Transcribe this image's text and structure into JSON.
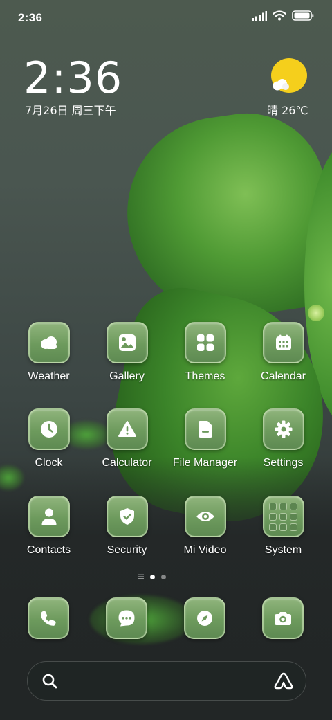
{
  "status_bar": {
    "time": "2:36"
  },
  "clock_widget": {
    "time": "2:36",
    "date": "7月26日 周三下午"
  },
  "weather_widget": {
    "condition": "晴",
    "temperature": "26℃"
  },
  "apps": [
    {
      "label": "Weather",
      "icon": "weather-icon"
    },
    {
      "label": "Gallery",
      "icon": "gallery-icon"
    },
    {
      "label": "Themes",
      "icon": "themes-icon"
    },
    {
      "label": "Calendar",
      "icon": "calendar-icon"
    },
    {
      "label": "Clock",
      "icon": "clock-icon"
    },
    {
      "label": "Calculator",
      "icon": "calculator-icon"
    },
    {
      "label": "File Manager",
      "icon": "file-manager-icon"
    },
    {
      "label": "Settings",
      "icon": "settings-icon"
    },
    {
      "label": "Contacts",
      "icon": "contacts-icon"
    },
    {
      "label": "Security",
      "icon": "security-icon"
    },
    {
      "label": "Mi Video",
      "icon": "mi-video-icon"
    },
    {
      "label": "System",
      "icon": "folder-icon"
    }
  ],
  "dock": [
    {
      "icon": "phone-icon"
    },
    {
      "icon": "messages-icon"
    },
    {
      "icon": "browser-icon"
    },
    {
      "icon": "camera-icon"
    }
  ],
  "page_indicator": {
    "pages": 2,
    "current": 1
  },
  "colors": {
    "icon_bg": "#7aa66a",
    "sun": "#f5cf1c",
    "leaf": "#4f9a34"
  }
}
